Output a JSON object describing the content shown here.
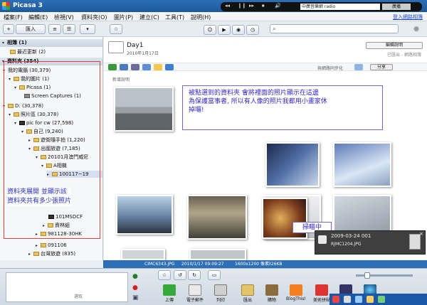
{
  "window": {
    "title": "Picasa 3"
  },
  "player": {
    "controls": [
      "◂◂",
      "❙❙",
      "▸▸",
      "⏹",
      "🔊"
    ],
    "station": "中廣音樂網 radio",
    "station_button": "廣播"
  },
  "menu": {
    "items": [
      "檔案(F)",
      "編輯(E)",
      "檢視(V)",
      "資料夾(O)",
      "圖片(P)",
      "建立(C)",
      "工具(T)",
      "說明(H)"
    ],
    "share_link": "登入網路相簿"
  },
  "toolbar": {
    "import_label": "匯入",
    "search_placeholder": ""
  },
  "tree": {
    "album_group": "相簿 (1)",
    "recent": "最近更新 (2)",
    "folders_group": "資料夾 (354)",
    "rows": [
      {
        "label": "我的電腦 (30,379)"
      },
      {
        "label": "我的圖片 (1)"
      },
      {
        "label": "Picasa (1)"
      },
      {
        "label": "Screen Captures (1)"
      },
      {
        "label": "D: (30,378)"
      },
      {
        "label": "照片區 (30,378)"
      },
      {
        "label": "pic for cw (27,598)"
      },
      {
        "label": "自己 (9,240)"
      },
      {
        "label": "遊街隨手拍 (1,220)"
      },
      {
        "label": "出國旅遊 (7,185)"
      },
      {
        "label": "20101月澳門威尼"
      },
      {
        "label": "A相機"
      },
      {
        "label": "100117~19"
      },
      {
        "label": "101MSDCF"
      },
      {
        "label": "資林組"
      },
      {
        "label": "981128-30HK"
      },
      {
        "label": "091106"
      },
      {
        "label": "台灣旅遊 (835)"
      }
    ],
    "note_line1": "資料夾展開 並顯示該",
    "note_line2": "資料夾共有多少張照片"
  },
  "album": {
    "title": "Day1",
    "date": "2010年1月17日",
    "edit_desc": "編輯說明",
    "status": "已匯出 - 網路相簿",
    "sync_label": "與網路同步化",
    "share": "分享",
    "add_desc": "新增說明"
  },
  "callout": {
    "line1": "被點選到的資料夾 會將裡面的照片顯示在這邊",
    "line2": "為保護當事者, 所以有人像的照片我都用小畫家休",
    "line3": "掉囉!"
  },
  "scan_label": "掃瞄中",
  "scan_popup": {
    "date": "2009-03-24 001",
    "file": "RJMC1204.JPG"
  },
  "infobar": {
    "filename": "CIMC6343.JPG",
    "datetime": "2010/1/17 09:09:27",
    "size": "1600x1200 像素",
    "filesize": "326KB"
  },
  "bottom": {
    "tray_label": "選取",
    "tools": [
      "上傳",
      "電子郵件",
      "列印",
      "匯出",
      "購物",
      "BlogThis!",
      "美術拼貼",
      "影片",
      "地球"
    ]
  }
}
